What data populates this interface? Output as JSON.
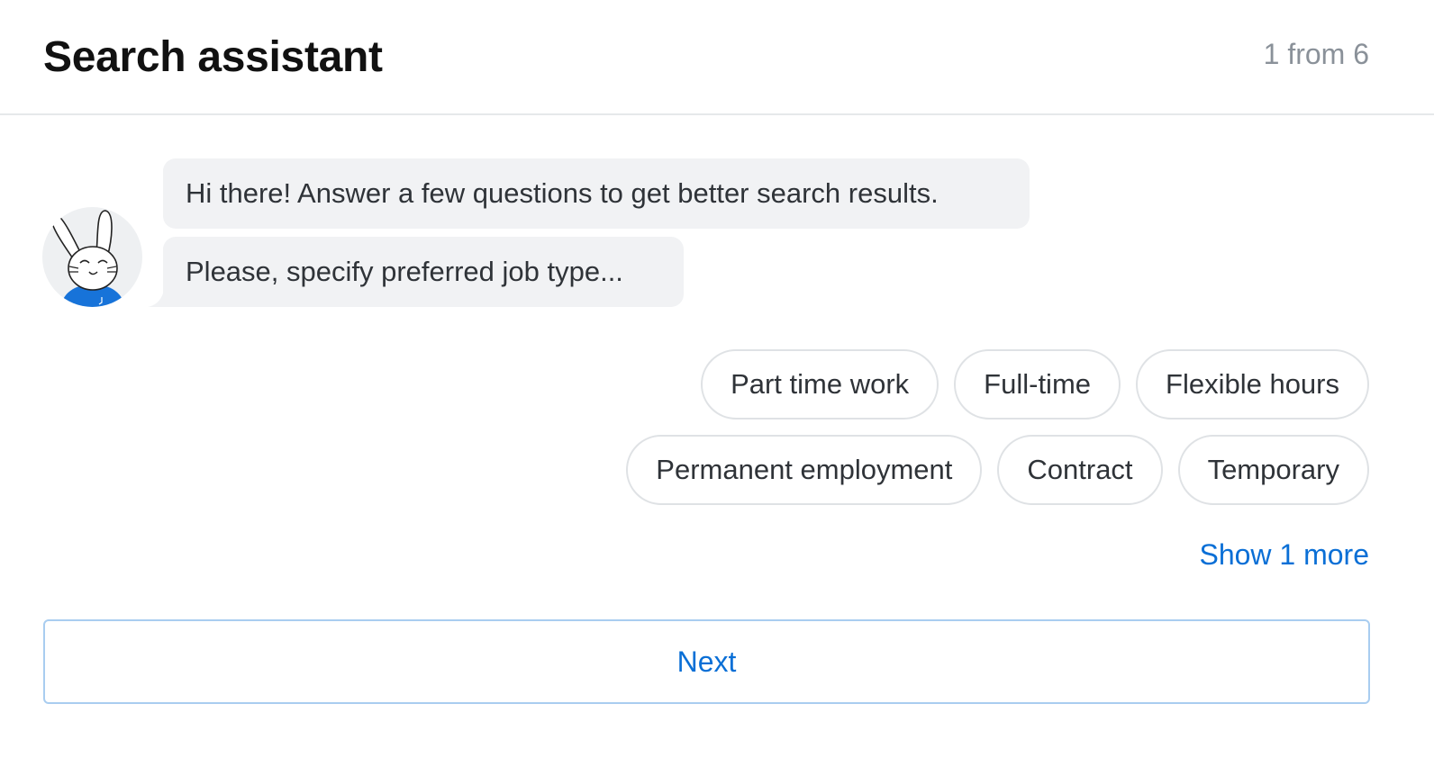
{
  "header": {
    "title": "Search assistant",
    "step": "1 from 6"
  },
  "avatar": {
    "icon": "bunny-mascot-icon"
  },
  "messages": [
    "Hi there! Answer a few questions to get better search results.",
    "Please, specify preferred job type..."
  ],
  "options": {
    "row1": [
      "Part time work",
      "Full-time",
      "Flexible hours"
    ],
    "row2": [
      "Permanent employment",
      "Contract",
      "Temporary"
    ]
  },
  "show_more": "Show 1 more",
  "next_button": "Next",
  "colors": {
    "accent": "#0a6fd6",
    "bubble_bg": "#f1f2f4",
    "chip_border": "#dfe2e5",
    "avatar_shirt": "#1773d9"
  }
}
